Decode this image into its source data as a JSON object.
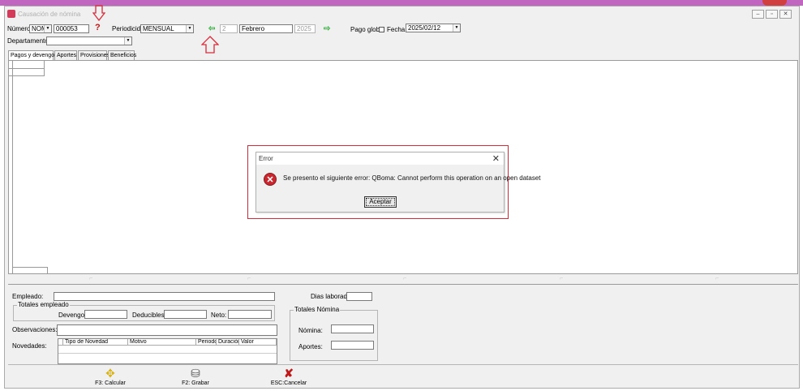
{
  "window": {
    "title": "Causación de nómina",
    "controls": {
      "minimize": "–",
      "restore": "▫",
      "close": "✕"
    }
  },
  "header": {
    "numero_label": "Número:",
    "numero_prefix": "NOM",
    "numero_value": "000053",
    "periodicidad_label": "Periodicidad:",
    "periodicidad_value": "MENSUAL",
    "period_number": "2",
    "period_month": "Febrero",
    "period_year": "2025",
    "pago_global_label": "Pago global",
    "fecha_label": "Fecha:",
    "fecha_value": "2025/02/12",
    "departamento_label": "Departamento:",
    "departamento_value": ""
  },
  "tabs": [
    {
      "label": "Pagos y devengos",
      "active": true
    },
    {
      "label": "Aportes",
      "active": false
    },
    {
      "label": "Provisiones",
      "active": false
    },
    {
      "label": "Beneficios",
      "active": false
    }
  ],
  "bottom": {
    "empleado_label": "Empleado:",
    "empleado_value": "",
    "dias_laborados_label": "Dias laborados:",
    "dias_laborados_value": "",
    "totales_empleado_title": "Totales empleado",
    "devengos_label": "Devengos:",
    "deducibles_label": "Deducibles:",
    "neto_label": "Neto:",
    "totales_nomina_title": "Totales Nómina",
    "nomina_label": "Nómina:",
    "aportes_label": "Aportes:",
    "observaciones_label": "Observaciones:",
    "novedades_label": "Novedades:",
    "novedades_columns": [
      "Tipo de Novedad",
      "Motivo",
      "Periodo",
      "Duración",
      "Valor"
    ]
  },
  "toolbar": {
    "calcular_label": "F3: Calcular",
    "grabar_label": "F2: Grabar",
    "cancelar_label": "ESC:Cancelar"
  },
  "dialog": {
    "title": "Error",
    "message": "Se presento el siguiente error: QBoma: Cannot perform this operation on an open dataset",
    "accept_label": "Aceptar",
    "close_glyph": "✕",
    "icon_glyph": "✕"
  },
  "colors": {
    "annotation_red": "#d62c3a",
    "nav_arrow_green": "#2fae3a",
    "error_icon": "#c8282f"
  }
}
